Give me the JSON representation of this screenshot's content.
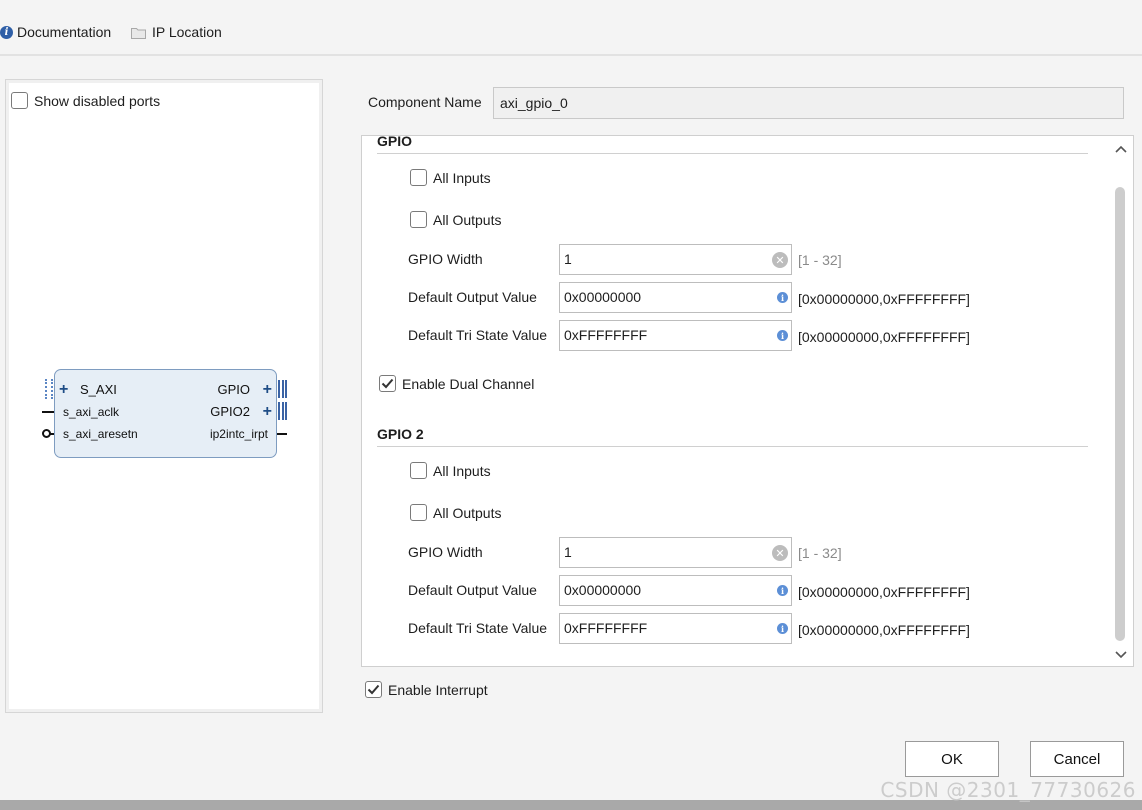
{
  "toolbar": {
    "documentation_label": "Documentation",
    "ip_location_label": "IP Location"
  },
  "preview": {
    "show_disabled_label": "Show disabled ports",
    "show_disabled_checked": false,
    "block": {
      "left_ports": [
        "S_AXI",
        "s_axi_aclk",
        "s_axi_aresetn"
      ],
      "right_ports": [
        "GPIO",
        "GPIO2",
        "ip2intc_irpt"
      ]
    }
  },
  "component": {
    "label": "Component Name",
    "value": "axi_gpio_0"
  },
  "gpio": {
    "title": "GPIO",
    "all_inputs_label": "All Inputs",
    "all_inputs_checked": false,
    "all_outputs_label": "All Outputs",
    "all_outputs_checked": false,
    "width_label": "GPIO Width",
    "width_value": "1",
    "width_range": "[1 - 32]",
    "dout_label": "Default Output Value",
    "dout_value": "0x00000000",
    "dout_range": "[0x00000000,0xFFFFFFFF]",
    "tri_label": "Default Tri State Value",
    "tri_value": "0xFFFFFFFF",
    "tri_range": "[0x00000000,0xFFFFFFFF]"
  },
  "dual_channel": {
    "label": "Enable Dual Channel",
    "checked": true
  },
  "gpio2": {
    "title": "GPIO 2",
    "all_inputs_label": "All Inputs",
    "all_inputs_checked": false,
    "all_outputs_label": "All Outputs",
    "all_outputs_checked": false,
    "width_label": "GPIO Width",
    "width_value": "1",
    "width_range": "[1 - 32]",
    "dout_label": "Default Output Value",
    "dout_value": "0x00000000",
    "dout_range": "[0x00000000,0xFFFFFFFF]",
    "tri_label": "Default Tri State Value",
    "tri_value": "0xFFFFFFFF",
    "tri_range": "[0x00000000,0xFFFFFFFF]"
  },
  "interrupt": {
    "label": "Enable Interrupt",
    "checked": true
  },
  "buttons": {
    "ok": "OK",
    "cancel": "Cancel"
  },
  "watermark": "CSDN @2301_77730626"
}
